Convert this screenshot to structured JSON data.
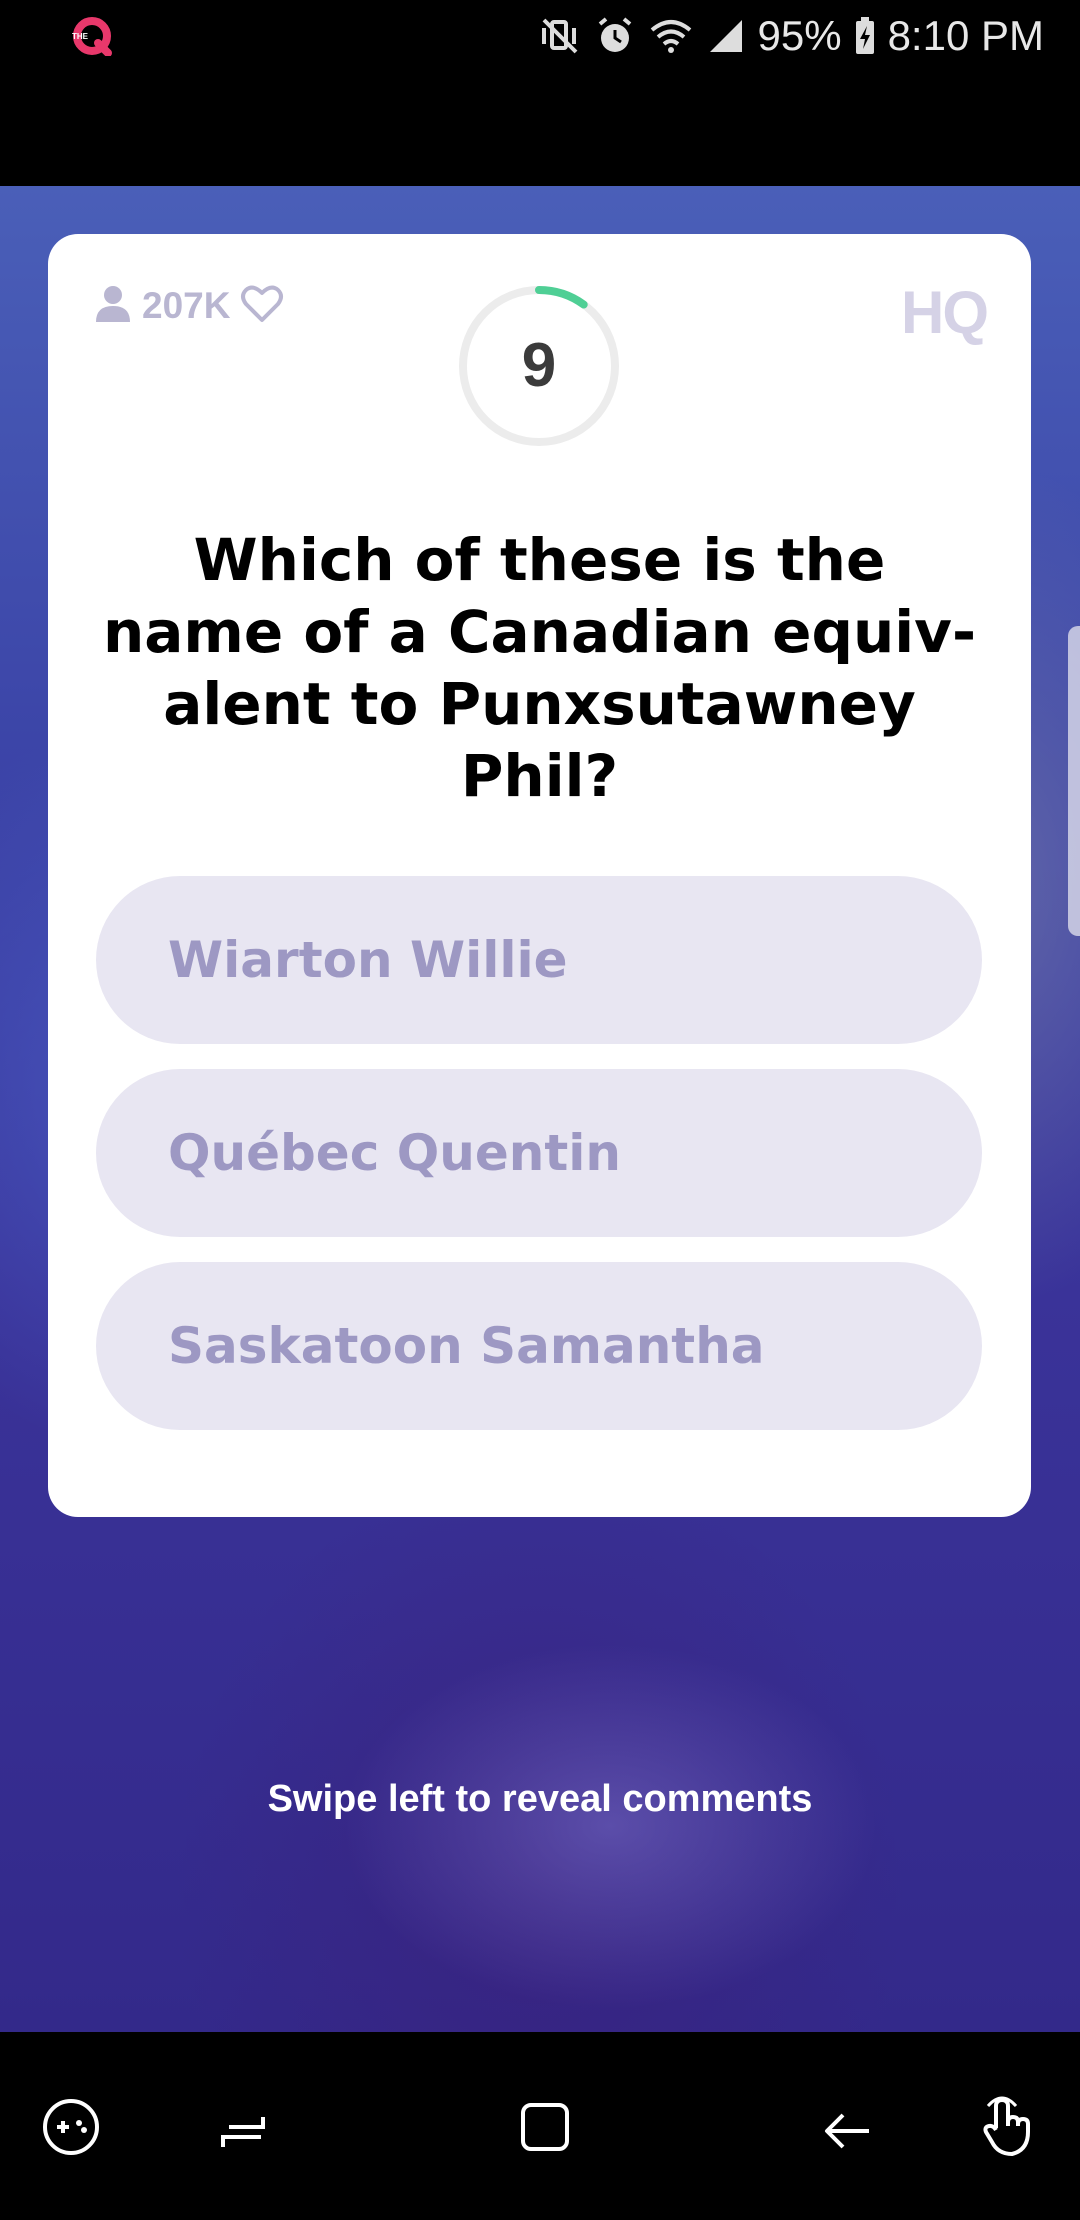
{
  "status_bar": {
    "app_icon": "hq-trivia-app-icon",
    "app_icon_small_text": "THE",
    "icons": [
      "vibrate-icon",
      "alarm-icon",
      "wifi-icon",
      "signal-icon"
    ],
    "battery_percent": "95%",
    "battery_icon": "battery-charging-icon",
    "time": "8:10 PM"
  },
  "card": {
    "viewers_icon": "user-icon",
    "viewer_count": "207K",
    "heart_icon": "heart-icon",
    "timer_value": "9",
    "timer_fraction_remaining": 0.9,
    "logo": "HQ",
    "question": "Which of these is the name of a Canadian equiv-alent to Punxsutawney Phil?",
    "answers": [
      {
        "label": "Wiarton Willie"
      },
      {
        "label": "Québec Quentin"
      },
      {
        "label": "Saskatoon Samantha"
      }
    ]
  },
  "swipe_hint": "Swipe left to reveal comments",
  "nav_bar": {
    "icons": [
      "game-tools-icon",
      "recent-apps-icon",
      "home-icon",
      "back-icon",
      "touch-gesture-icon"
    ]
  },
  "colors": {
    "timer_progress": "#4fcf95",
    "answer_bg": "#e8e6f2",
    "answer_text": "#9d98c3",
    "muted": "#b9b6d1",
    "background_blue": "#3c45a8"
  }
}
